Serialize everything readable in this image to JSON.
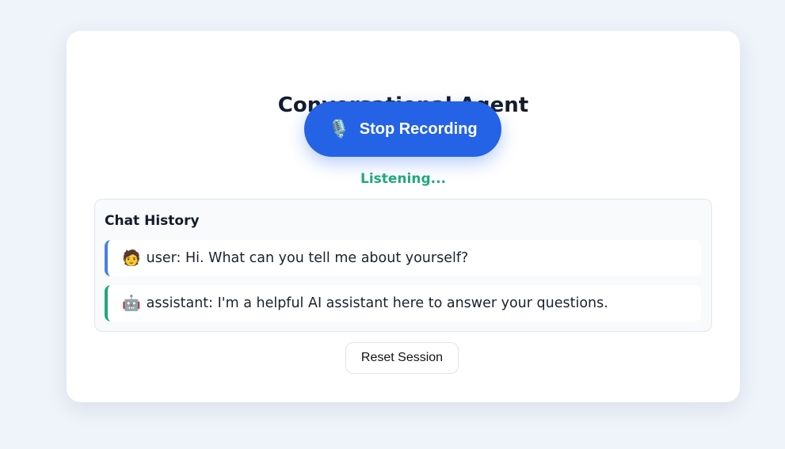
{
  "app": {
    "title": "Conversational Agent"
  },
  "record_button": {
    "icon": "microphone-icon",
    "icon_glyph": "🎙️",
    "label": "Stop Recording",
    "color": "#2462e6"
  },
  "status": {
    "text": "Listening...",
    "color": "#1fa97a"
  },
  "chat_history": {
    "title": "Chat History",
    "messages": [
      {
        "role": "user",
        "avatar_icon": "user-avatar-icon",
        "avatar_glyph": "🧑",
        "text": "user: Hi. What can you tell me about yourself?",
        "accent": "#4a7fe0"
      },
      {
        "role": "assistant",
        "avatar_icon": "robot-avatar-icon",
        "avatar_glyph": "🤖",
        "text": "assistant: I'm a helpful AI assistant here to answer your questions.",
        "accent": "#21a87a"
      }
    ]
  },
  "reset_button": {
    "label": "Reset Session"
  }
}
